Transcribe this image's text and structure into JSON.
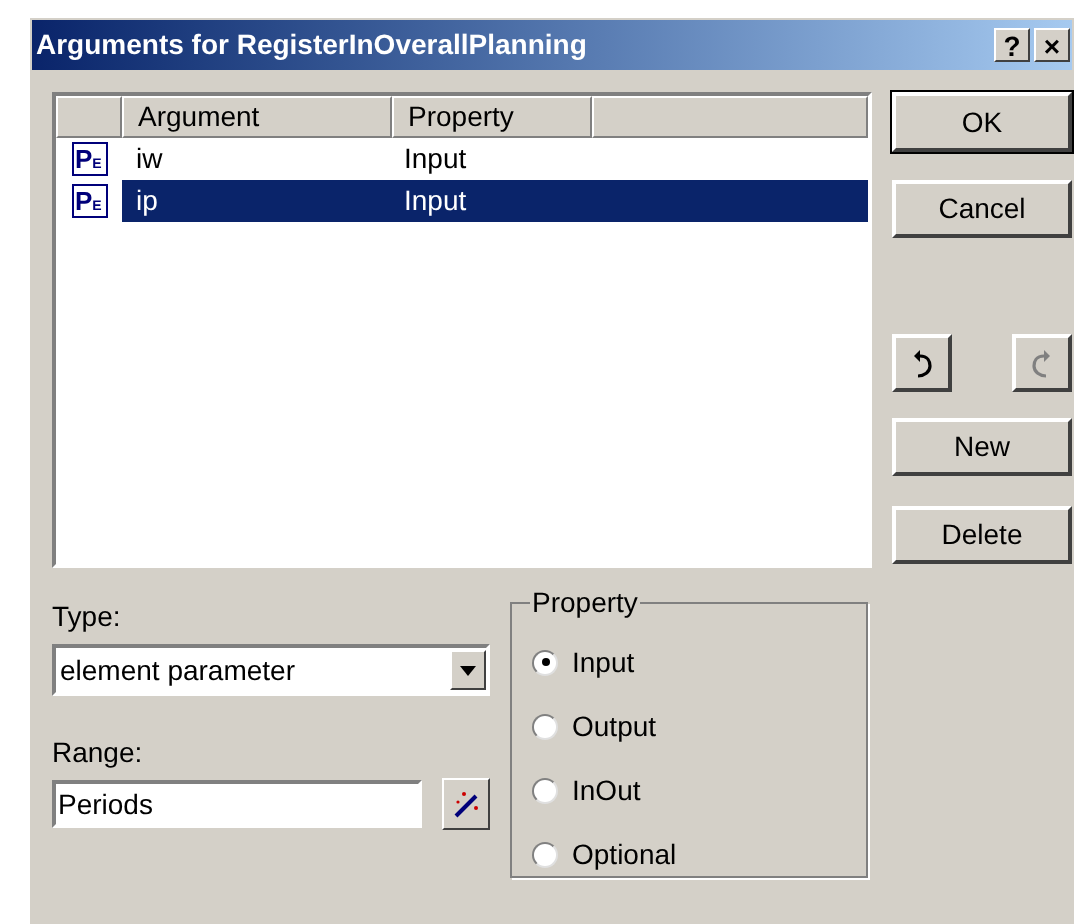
{
  "window": {
    "title": "Arguments for RegisterInOverallPlanning",
    "title_buttons": [
      "?",
      "×"
    ]
  },
  "list": {
    "columns": [
      "Argument",
      "Property"
    ],
    "rows": [
      {
        "icon_letter": "P",
        "icon_sub": "E",
        "argument": "iw",
        "property": "Input",
        "selected": false
      },
      {
        "icon_letter": "P",
        "icon_sub": "E",
        "argument": "ip",
        "property": "Input",
        "selected": true
      }
    ]
  },
  "buttons": {
    "ok": "OK",
    "cancel": "Cancel",
    "new": "New",
    "delete": "Delete",
    "undo": {
      "disabled": false
    },
    "redo": {
      "disabled": true
    }
  },
  "type": {
    "label": "Type:",
    "value": "element parameter"
  },
  "range": {
    "label": "Range:",
    "value": "Periods"
  },
  "property_group": {
    "title": "Property",
    "options": [
      {
        "label": "Input",
        "selected": true
      },
      {
        "label": "Output",
        "selected": false
      },
      {
        "label": "InOut",
        "selected": false
      },
      {
        "label": "Optional",
        "selected": false
      }
    ]
  }
}
